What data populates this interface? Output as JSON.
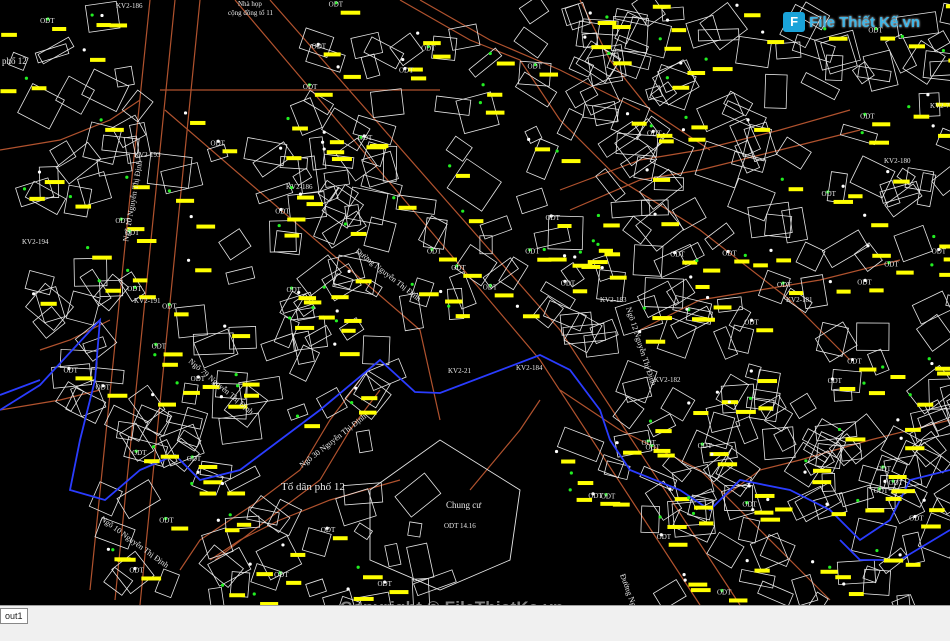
{
  "map": {
    "labels": {
      "logo": "File Thiết Kế.vn",
      "copyright": "Copyright © FileThietKe.vn",
      "layout_tab": "out1",
      "to_dan_pho": "Tổ dân phố 12",
      "chung_cu": "Chung cư",
      "chung_cu_code": "ODT 14.16",
      "nha_hop_top": "Nhà họp",
      "nha_hop_bottom": "cộng đồng tổ 11",
      "street_tkd": "Đường Nguyễn Thị Định",
      "street_tkd_bottom": "Đường Nguyễn",
      "lane_ntd_1": "Ngõ 10 Nguyễn Thị Định",
      "lane_ntd_2": "Ngõ 30 Nguyễn Thị Định",
      "lane_ntd_3": "Ngõ 10 Nguyễn Thị Định",
      "lane_ntd_4": "Ngõ 79 Nguyễn Thị Định",
      "lane_ntd_5": "Ngõ 12 Nguyễn Thị Định",
      "to_dan_pho_left": "phố 12",
      "kv_1": "KV2-186",
      "kv_2": "KV2-184",
      "kv_3": "KV2-21",
      "kv_4": "KV2-182",
      "kv_5": "KV2-183",
      "kv_6": "KV2-181",
      "kv_7": "KV2-180",
      "kv_8": "KV2-193",
      "kv_9": "KV2-191",
      "kv_10": "KV2-186",
      "kv_11": "KV2-194",
      "kv_12": "KV2-7"
    },
    "parcel_codes": [
      "ODT",
      "ODT",
      "ODT",
      "ODT",
      "ODT",
      "ODT",
      "ODT",
      "ODT",
      "ODT",
      "ODT",
      "ODT",
      "ODT",
      "ODT",
      "ODT",
      "ODT",
      "ODT",
      "ODT",
      "ODT",
      "ODT",
      "ODT"
    ],
    "colors": {
      "background": "#000000",
      "parcel_lines": "#e6e6e6",
      "road_edges": "#b0522e",
      "boundary": "#2a3cff",
      "labels": "#ffff00",
      "markers": "#22ee22",
      "text": "#e8e8e8"
    }
  }
}
